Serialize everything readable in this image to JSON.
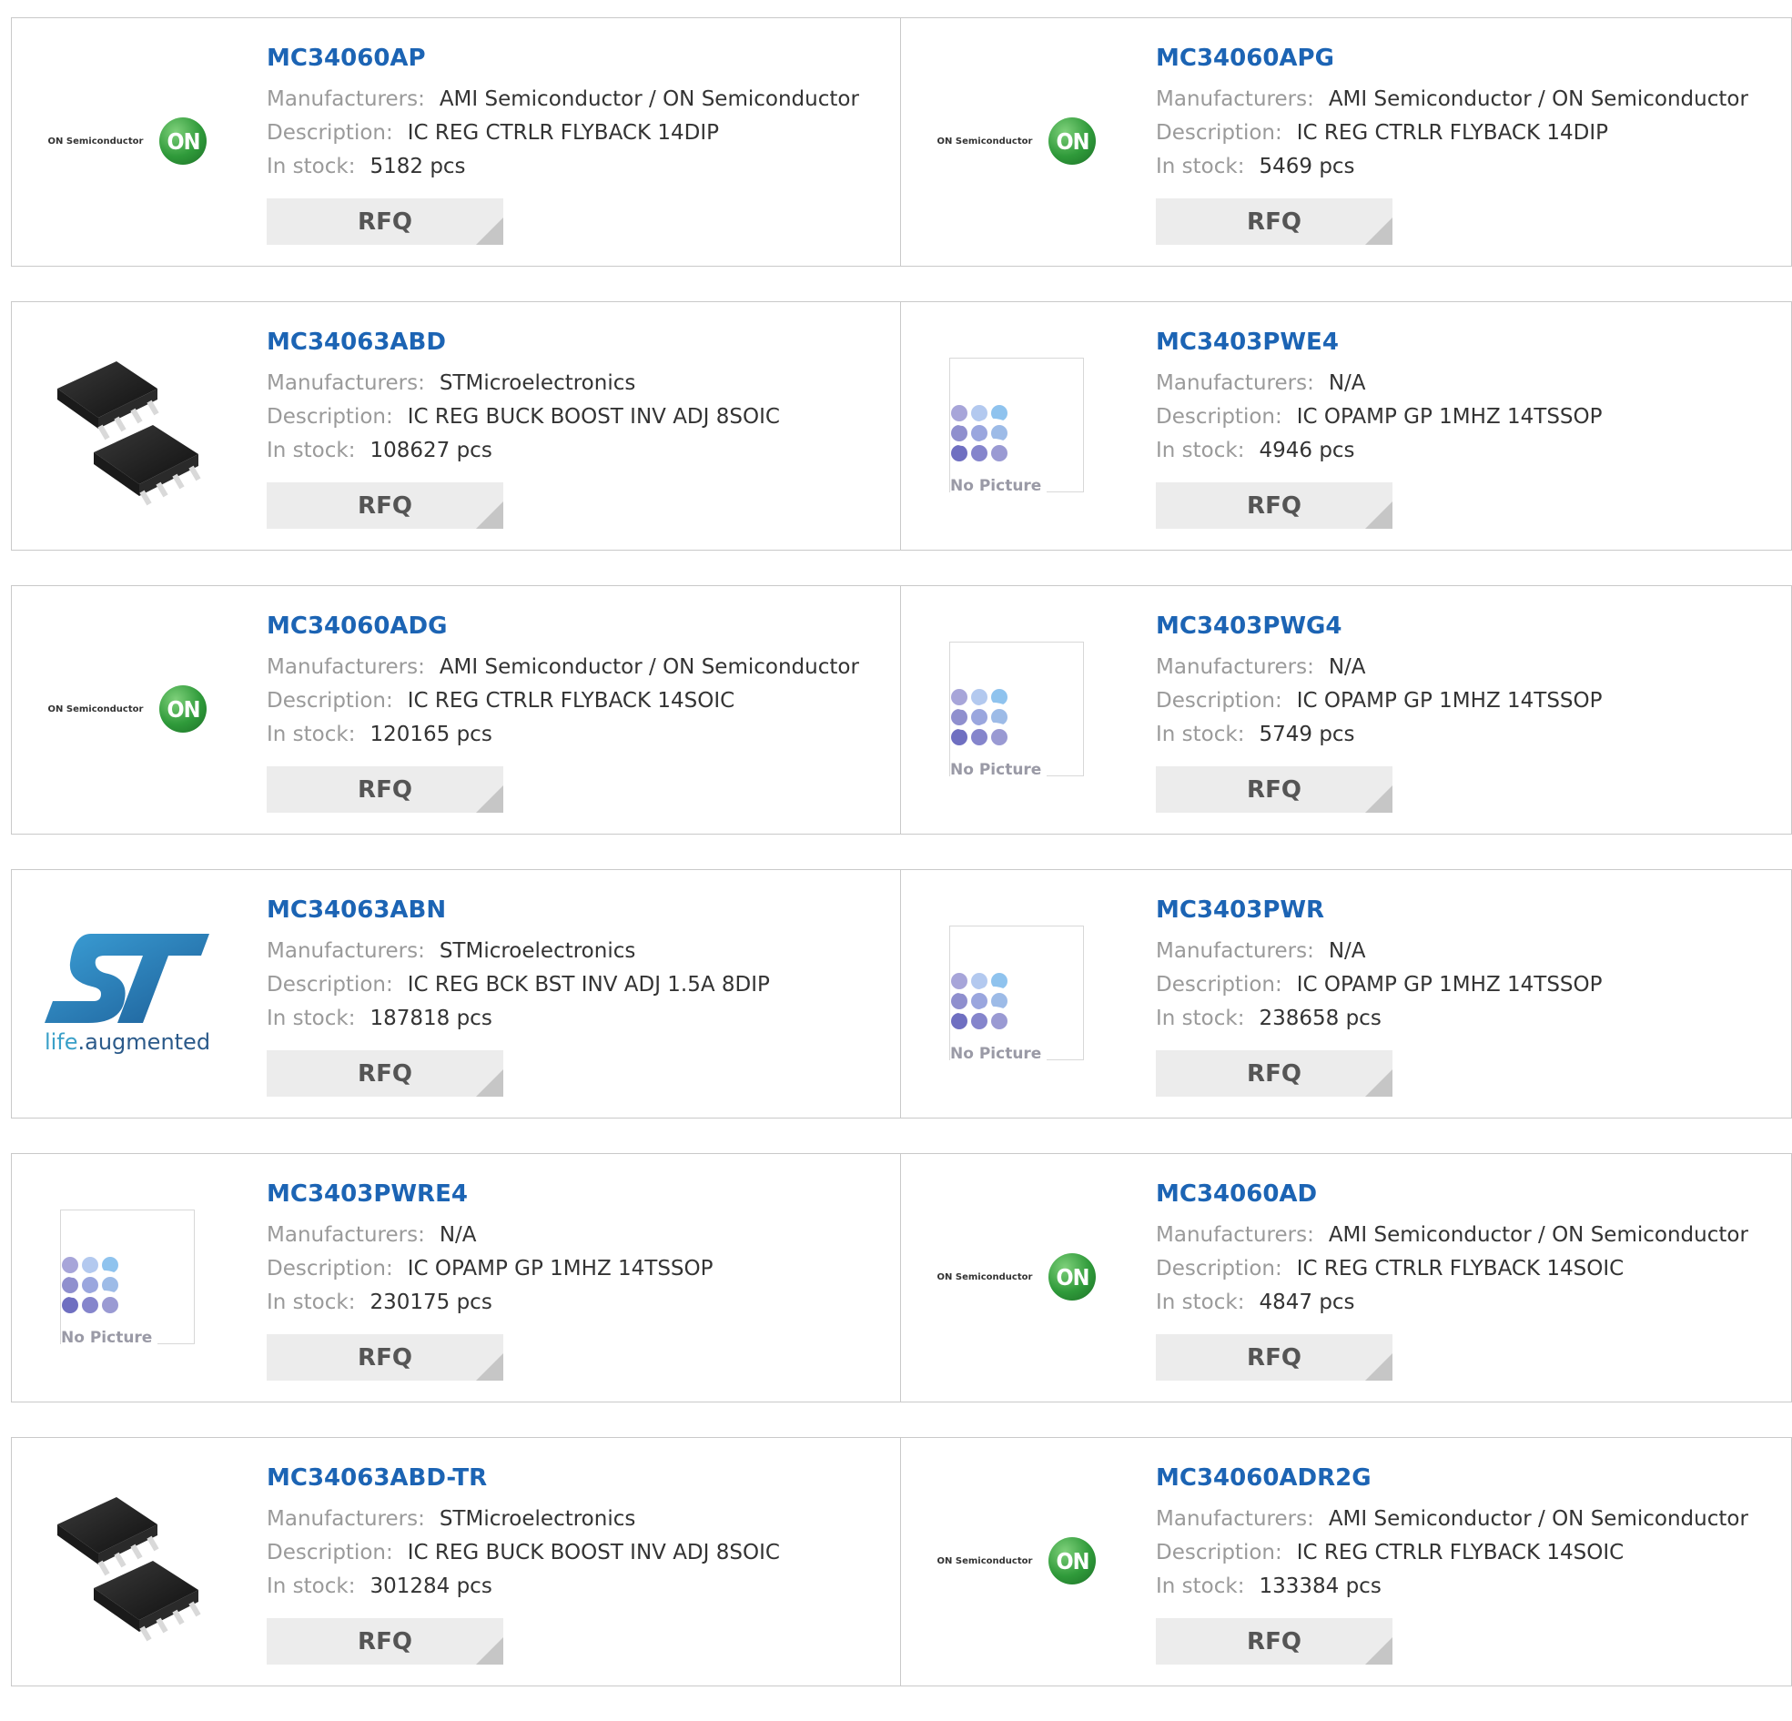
{
  "labels": {
    "manufacturers": "Manufacturers:",
    "description": "Description:",
    "in_stock": "In stock:",
    "rfq": "RFQ"
  },
  "logos": {
    "on_text": "ON Semiconductor",
    "on_circle": "ON",
    "no_picture": "No Picture",
    "st_life": "life",
    "st_dot": ".",
    "st_augmented": "augmented"
  },
  "colors": {
    "part_link": "#1c64b4",
    "label_gray": "#9a9a9a",
    "rfq_bg": "#ececec",
    "border": "#c9c9c9"
  },
  "rows": [
    [
      {
        "image": "on-semiconductor-logo",
        "part": "MC34060AP",
        "manufacturer": "AMI Semiconductor / ON Semiconductor",
        "description": "IC REG CTRLR FLYBACK 14DIP",
        "stock": "5182 pcs"
      },
      {
        "image": "on-semiconductor-logo",
        "part": "MC34060APG",
        "manufacturer": "AMI Semiconductor / ON Semiconductor",
        "description": "IC REG CTRLR FLYBACK 14DIP",
        "stock": "5469 pcs"
      }
    ],
    [
      {
        "image": "soic-chip-photo",
        "part": "MC34063ABD",
        "manufacturer": "STMicroelectronics",
        "description": "IC REG BUCK BOOST INV ADJ 8SOIC",
        "stock": "108627 pcs"
      },
      {
        "image": "no-picture",
        "part": "MC3403PWE4",
        "manufacturer": "N/A",
        "description": "IC OPAMP GP 1MHZ 14TSSOP",
        "stock": "4946 pcs"
      }
    ],
    [
      {
        "image": "on-semiconductor-logo",
        "part": "MC34060ADG",
        "manufacturer": "AMI Semiconductor / ON Semiconductor",
        "description": "IC REG CTRLR FLYBACK 14SOIC",
        "stock": "120165 pcs"
      },
      {
        "image": "no-picture",
        "part": "MC3403PWG4",
        "manufacturer": "N/A",
        "description": "IC OPAMP GP 1MHZ 14TSSOP",
        "stock": "5749 pcs"
      }
    ],
    [
      {
        "image": "st-logo",
        "part": "MC34063ABN",
        "manufacturer": "STMicroelectronics",
        "description": "IC REG BCK BST INV ADJ 1.5A 8DIP",
        "stock": "187818 pcs"
      },
      {
        "image": "no-picture",
        "part": "MC3403PWR",
        "manufacturer": "N/A",
        "description": "IC OPAMP GP 1MHZ 14TSSOP",
        "stock": "238658 pcs"
      }
    ],
    [
      {
        "image": "no-picture",
        "part": "MC3403PWRE4",
        "manufacturer": "N/A",
        "description": "IC OPAMP GP 1MHZ 14TSSOP",
        "stock": "230175 pcs"
      },
      {
        "image": "on-semiconductor-logo",
        "part": "MC34060AD",
        "manufacturer": "AMI Semiconductor / ON Semiconductor",
        "description": "IC REG CTRLR FLYBACK 14SOIC",
        "stock": "4847 pcs"
      }
    ],
    [
      {
        "image": "soic-chip-photo",
        "part": "MC34063ABD-TR",
        "manufacturer": "STMicroelectronics",
        "description": "IC REG BUCK BOOST INV ADJ 8SOIC",
        "stock": "301284 pcs"
      },
      {
        "image": "on-semiconductor-logo",
        "part": "MC34060ADR2G",
        "manufacturer": "AMI Semiconductor / ON Semiconductor",
        "description": "IC REG CTRLR FLYBACK 14SOIC",
        "stock": "133384 pcs"
      }
    ]
  ]
}
